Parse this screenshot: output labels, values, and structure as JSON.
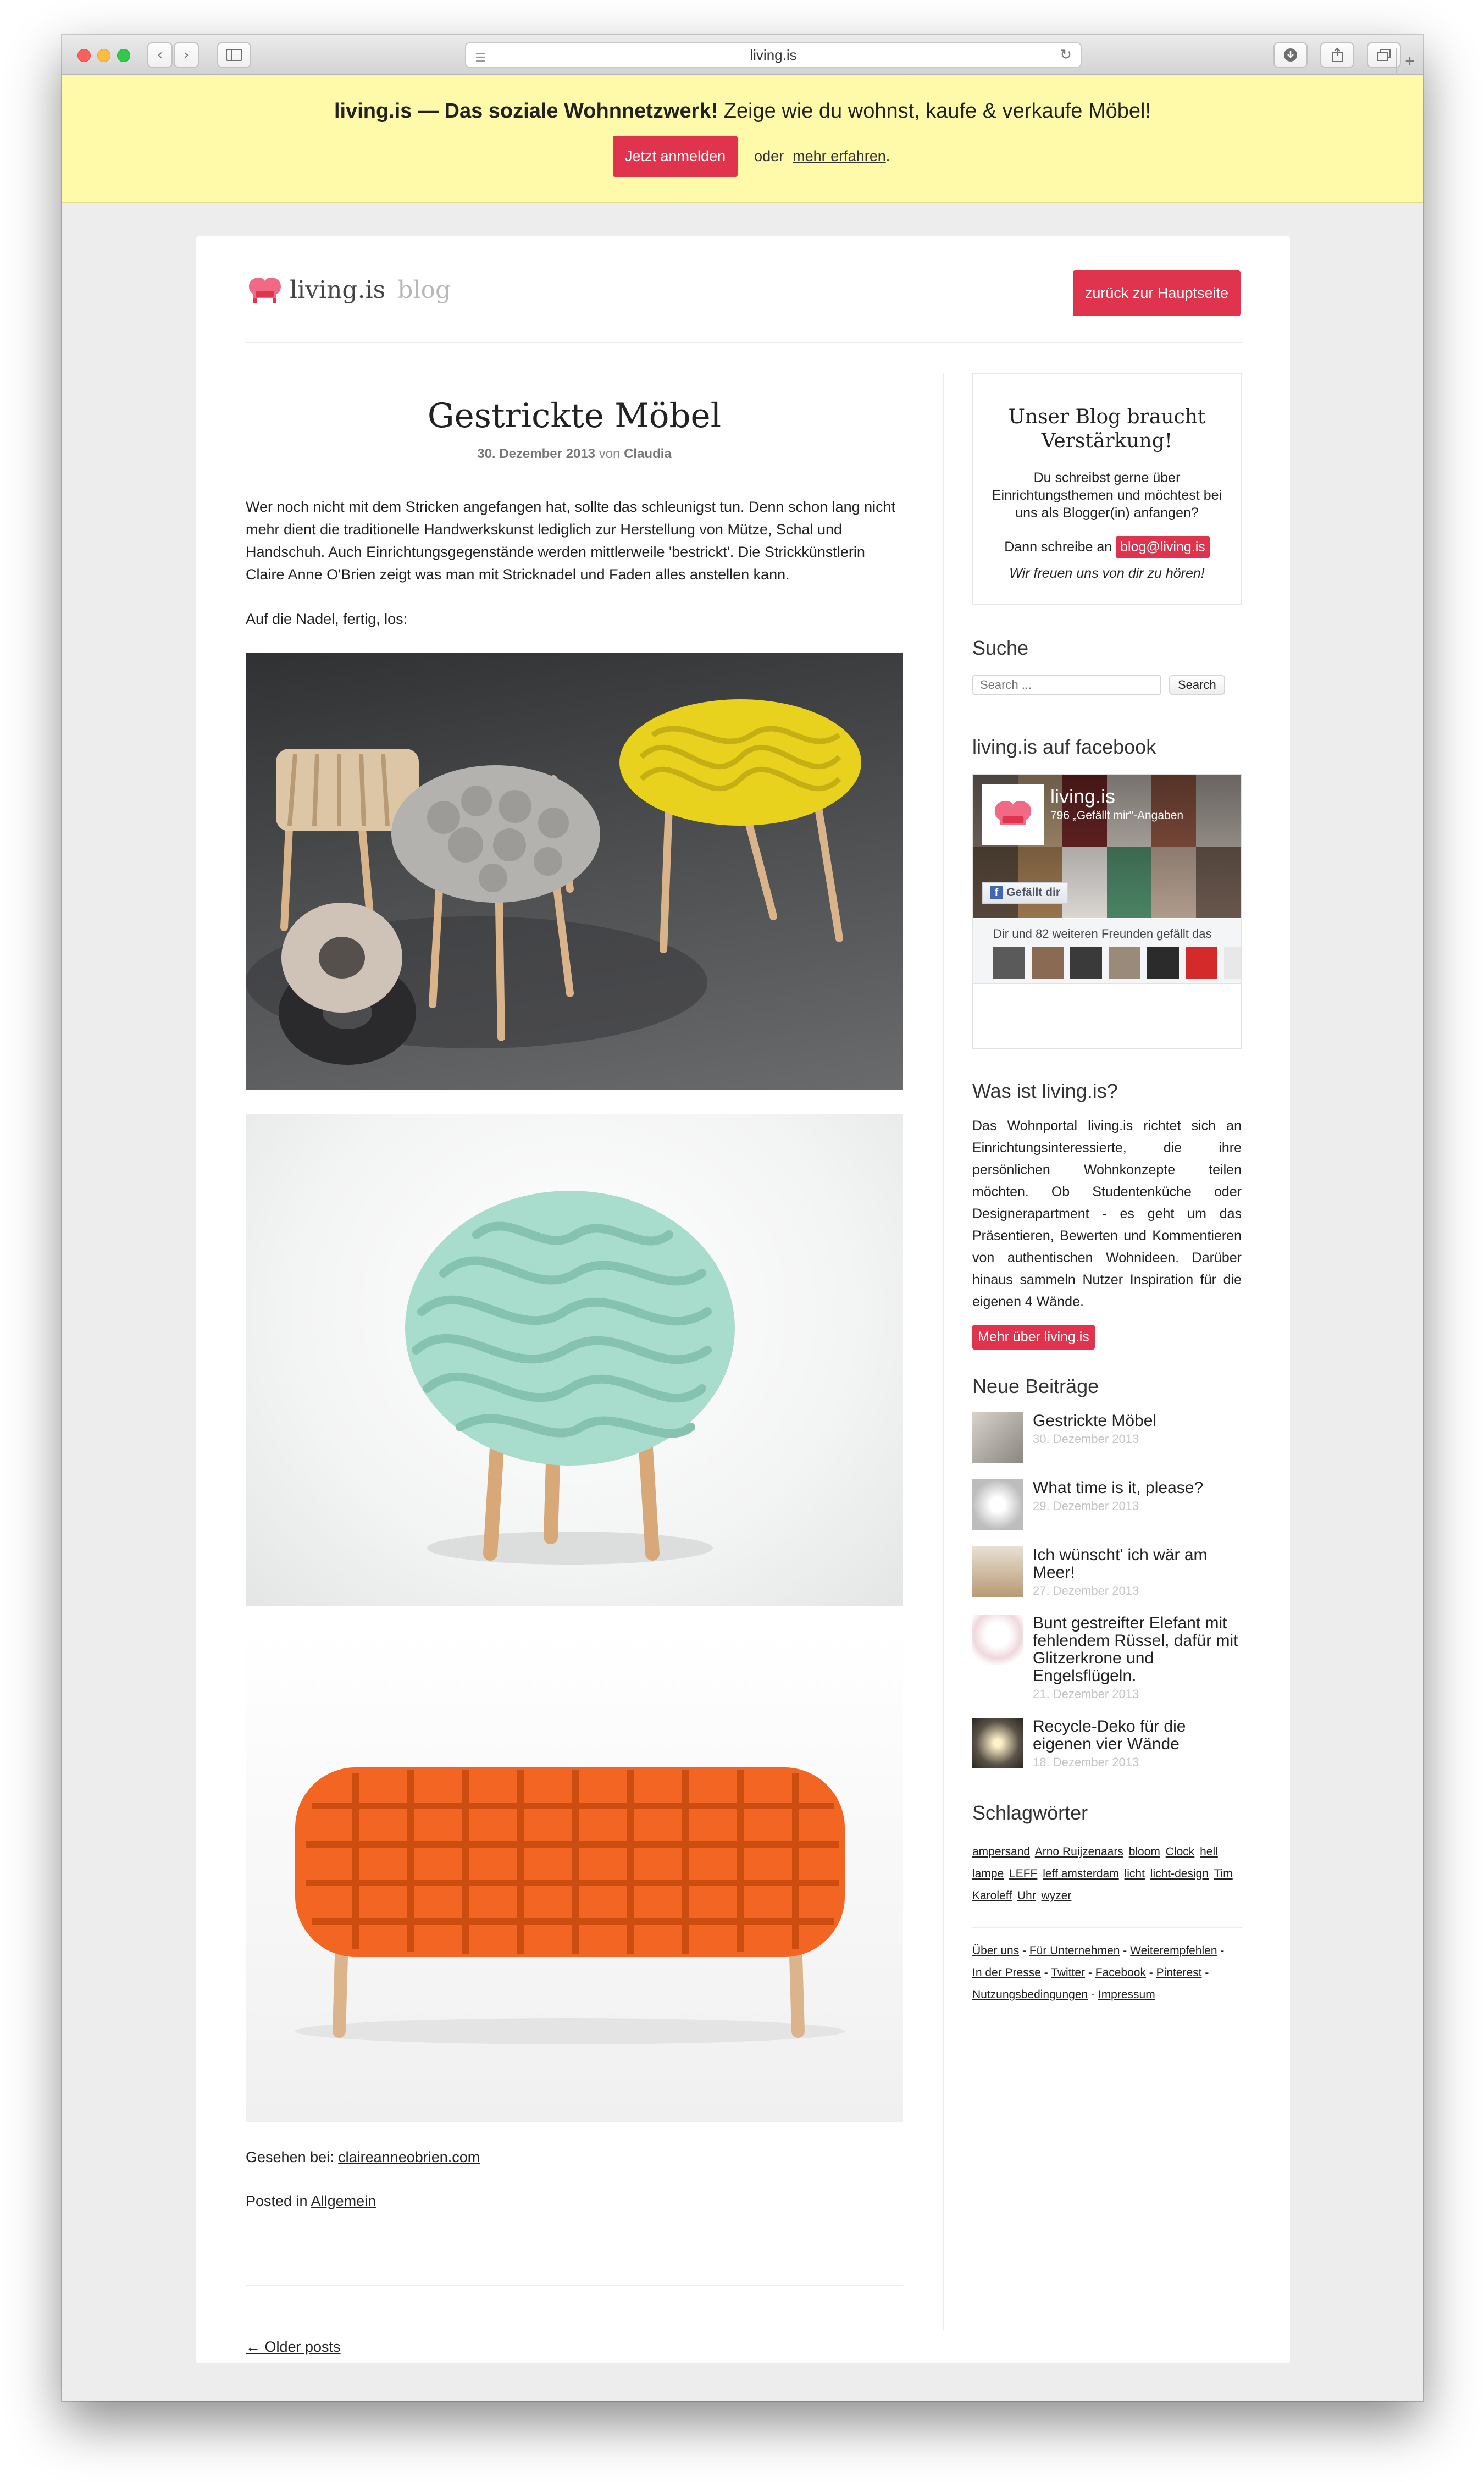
{
  "browser": {
    "url": "living.is"
  },
  "banner": {
    "brand": "living.is — Das soziale Wohnnetzwerk!",
    "tagline": "Zeige wie du wohnst, kaufe & verkaufe Möbel!",
    "signup_label": "Jetzt anmelden",
    "or_label": "oder",
    "learn_more_label": "mehr erfahren",
    "learn_more_suffix": "."
  },
  "header": {
    "logo_text": "living.is",
    "logo_blog": "blog",
    "back_label": "zurück zur Hauptseite"
  },
  "post": {
    "title": "Gestrickte Möbel",
    "date": "30. Dezember 2013",
    "by": "von",
    "author": "Claudia",
    "paragraph1": "Wer noch nicht mit dem Stricken angefangen hat, sollte das schleunigst tun. Denn schon lang nicht mehr dient die traditionelle Handwerkskunst lediglich zur Herstellung von Mütze, Schal und Handschuh. Auch Einrichtungsgegenstände werden mittlerweile 'bestrickt'. Die Strickkünstlerin Claire Anne O'Brien zeigt was man mit Stricknadel und Faden alles anstellen kann.",
    "paragraph2": "Auf die Nadel, fertig, los:",
    "seen_label": "Gesehen bei:",
    "seen_link": "claireanneobrien.com",
    "posted_label": "Posted in",
    "category": "Allgemein"
  },
  "older_posts": "← Older posts",
  "sidebar": {
    "join": {
      "title": "Unser Blog braucht Verstärkung!",
      "text": "Du schreibst gerne über Einrichtungsthemen und möchtest bei uns als Blogger(in) anfangen?",
      "contact_prefix": "Dann schreibe an",
      "email": "blog@living.is",
      "thanks": "Wir freuen uns von dir zu hören!"
    },
    "search": {
      "title": "Suche",
      "placeholder": "Search ...",
      "button": "Search"
    },
    "facebook": {
      "title": "living.is auf facebook",
      "page_name": "living.is",
      "likes": "796 „Gefällt mir\"-Angaben",
      "like_button": "Gefällt dir",
      "friends_text": "Dir und 82 weiteren Freunden gefällt das"
    },
    "about": {
      "title": "Was ist living.is?",
      "text": "Das Wohnportal living.is richtet sich an Einrichtungsinteressierte, die ihre persönlichen Wohnkonzepte teilen möchten. Ob Studentenküche oder Designerapartment - es geht um das Präsentieren, Bewerten und Kommentieren von authentischen Wohnideen. Darüber hinaus sammeln Nutzer Inspiration für die eigenen 4 Wände.",
      "button": "Mehr über living.is"
    },
    "recent": {
      "title": "Neue Beiträge",
      "items": [
        {
          "title": "Gestrickte Möbel",
          "date": "30. Dezember 2013"
        },
        {
          "title": "What time is it, please?",
          "date": "29. Dezember 2013"
        },
        {
          "title": "Ich wünscht' ich wär am Meer!",
          "date": "27. Dezember 2013"
        },
        {
          "title": "Bunt gestreifter Elefant mit fehlendem Rüssel, dafür mit Glitzerkrone und Engelsflügeln.",
          "date": "21. Dezember 2013"
        },
        {
          "title": "Recycle-Deko für die eigenen vier Wände",
          "date": "18. Dezember 2013"
        }
      ]
    },
    "tags": {
      "title": "Schlagwörter",
      "items": [
        "ampersand",
        "Arno Ruijzenaars",
        "bloom",
        "Clock",
        "hell",
        "lampe",
        "LEFF",
        "leff amsterdam",
        "licht",
        "licht-design",
        "Tim",
        "Karoleff",
        "Uhr",
        "wyzer"
      ]
    },
    "footer_links": [
      "Über uns",
      "Für Unternehmen",
      "Weiterempfehlen",
      "In der Presse",
      "Twitter",
      "Facebook",
      "Pinterest",
      "Nutzungsbedingungen",
      "Impressum"
    ],
    "separator": " - "
  },
  "colors": {
    "accent": "#e0334e",
    "banner_bg": "#fffaaa",
    "page_bg": "#ededed"
  }
}
